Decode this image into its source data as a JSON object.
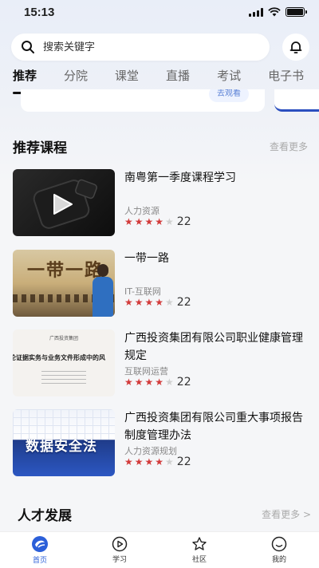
{
  "status": {
    "time": "15:13"
  },
  "search": {
    "placeholder": "搜索关键字"
  },
  "tabs": [
    {
      "label": "推荐",
      "active": true
    },
    {
      "label": "分院",
      "active": false
    },
    {
      "label": "课堂",
      "active": false
    },
    {
      "label": "直播",
      "active": false
    },
    {
      "label": "考试",
      "active": false
    },
    {
      "label": "电子书",
      "active": false
    }
  ],
  "banner": {
    "tag": "去观看"
  },
  "recommended": {
    "title": "推荐课程",
    "more": "查看更多",
    "courses": [
      {
        "title": "南粤第一季度课程学习",
        "category": "人力资源",
        "stars": 4,
        "score": "22"
      },
      {
        "title": "一带一路",
        "category": "IT-互联网",
        "stars": 4,
        "score": "22"
      },
      {
        "title": "广西投资集团有限公司职业健康管理规定",
        "category": "互联网运营",
        "stars": 4,
        "score": "22"
      },
      {
        "title": "广西投资集团有限公司重大事项报告制度管理办法",
        "category": "人力资源规划",
        "stars": 4,
        "score": "22"
      }
    ]
  },
  "thumb_text": {
    "c2": "一带一路",
    "c3_line1": "广西投资集团",
    "c3_line2": "论证据实务与业务文件形成中的风",
    "c4": "数据安全法"
  },
  "talent": {
    "title": "人才发展",
    "more": "查看更多 >"
  },
  "nav": [
    {
      "label": "首页",
      "icon": "home-logo-icon",
      "active": true
    },
    {
      "label": "学习",
      "icon": "play-circle-icon",
      "active": false
    },
    {
      "label": "社区",
      "icon": "star-icon",
      "active": false
    },
    {
      "label": "我的",
      "icon": "smile-face-icon",
      "active": false
    }
  ],
  "colors": {
    "accent": "#2b5fd9",
    "star": "#d23b3b"
  }
}
